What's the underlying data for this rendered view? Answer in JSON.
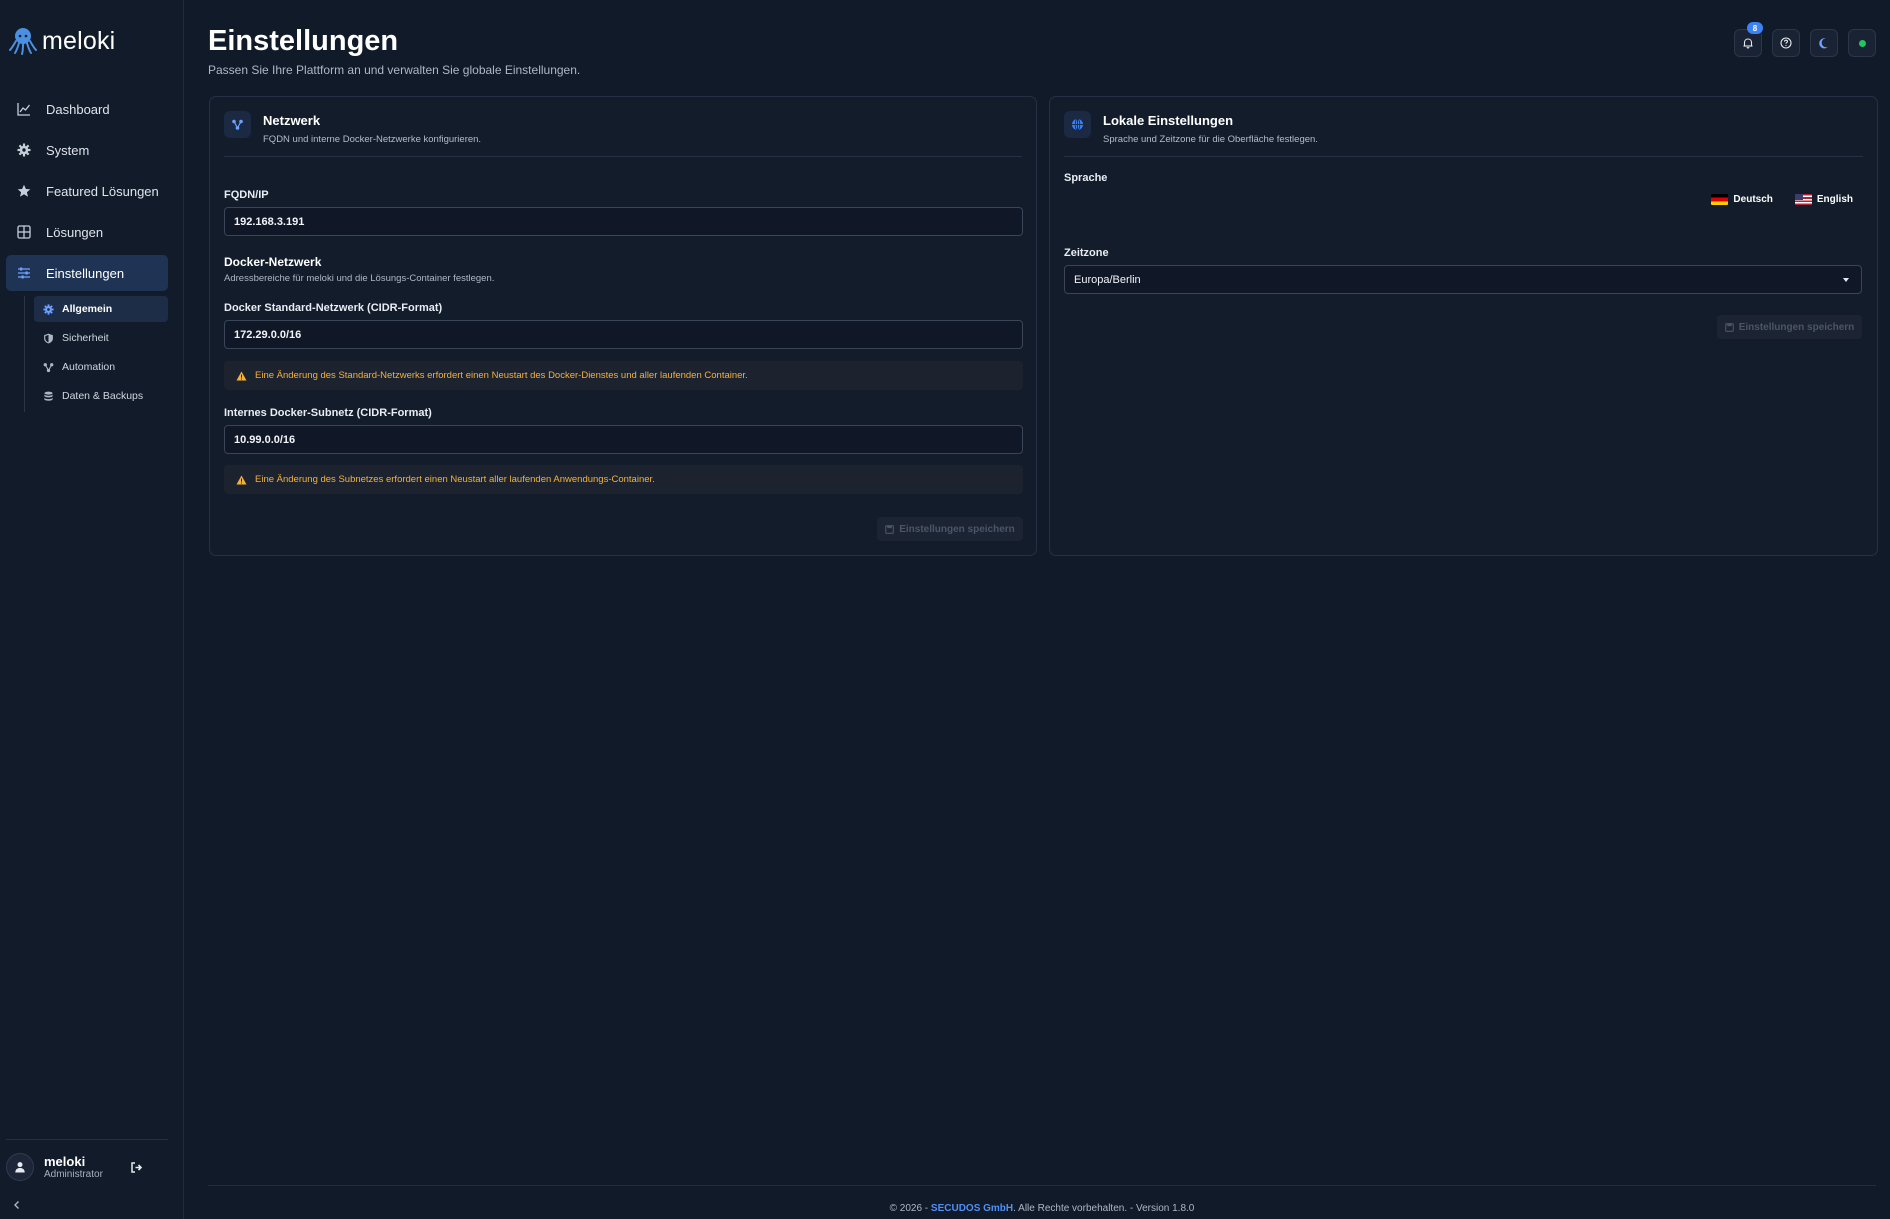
{
  "app": {
    "name": "meloki"
  },
  "sidebar": {
    "items": [
      {
        "label": "Dashboard",
        "icon": "chart-line-icon"
      },
      {
        "label": "System",
        "icon": "gear-icon"
      },
      {
        "label": "Featured Lösungen",
        "icon": "star-icon"
      },
      {
        "label": "Lösungen",
        "icon": "grid-icon"
      },
      {
        "label": "Einstellungen",
        "icon": "sliders-icon",
        "active": true
      }
    ],
    "subitems": [
      {
        "label": "Allgemein",
        "icon": "gear-icon",
        "active": true
      },
      {
        "label": "Sicherheit",
        "icon": "shield-icon"
      },
      {
        "label": "Automation",
        "icon": "network-icon"
      },
      {
        "label": "Daten & Backups",
        "icon": "database-icon"
      }
    ],
    "user": {
      "name": "meloki",
      "role": "Administrator"
    }
  },
  "header": {
    "title": "Einstellungen",
    "subtitle": "Passen Sie Ihre Plattform an und verwalten Sie globale Einstellungen.",
    "notification_count": "8"
  },
  "network_card": {
    "title": "Netzwerk",
    "description": "FQDN und interne Docker-Netzwerke konfigurieren.",
    "fqdn_label": "FQDN/IP",
    "fqdn_value": "192.168.3.191",
    "docker_title": "Docker-Netzwerk",
    "docker_desc": "Adressbereiche für meloki und die Lösungs-Container festlegen.",
    "std_label": "Docker Standard-Netzwerk (CIDR-Format)",
    "std_value": "172.29.0.0/16",
    "std_warning": "Eine Änderung des Standard-Netzwerks erfordert einen Neustart des Docker-Dienstes und aller laufenden Container.",
    "subnet_label": "Internes Docker-Subnetz (CIDR-Format)",
    "subnet_value": "10.99.0.0/16",
    "subnet_warning": "Eine Änderung des Subnetzes erfordert einen Neustart aller laufenden Anwendungs-Container.",
    "save_label": "Einstellungen speichern"
  },
  "locale_card": {
    "title": "Lokale Einstellungen",
    "description": "Sprache und Zeitzone für die Oberfläche festlegen.",
    "language_label": "Sprache",
    "lang_de": "Deutsch",
    "lang_en": "English",
    "timezone_label": "Zeitzone",
    "timezone_value": "Europa/Berlin",
    "save_label": "Einstellungen speichern"
  },
  "footer": {
    "prefix": "© 2026 - ",
    "brand": "SECUDOS GmbH",
    "suffix": ". Alle Rechte vorbehalten. - Version 1.8.0"
  },
  "colors": {
    "accent": "#3b82f6",
    "warning": "#f5b13b",
    "status": "#22c55e"
  }
}
